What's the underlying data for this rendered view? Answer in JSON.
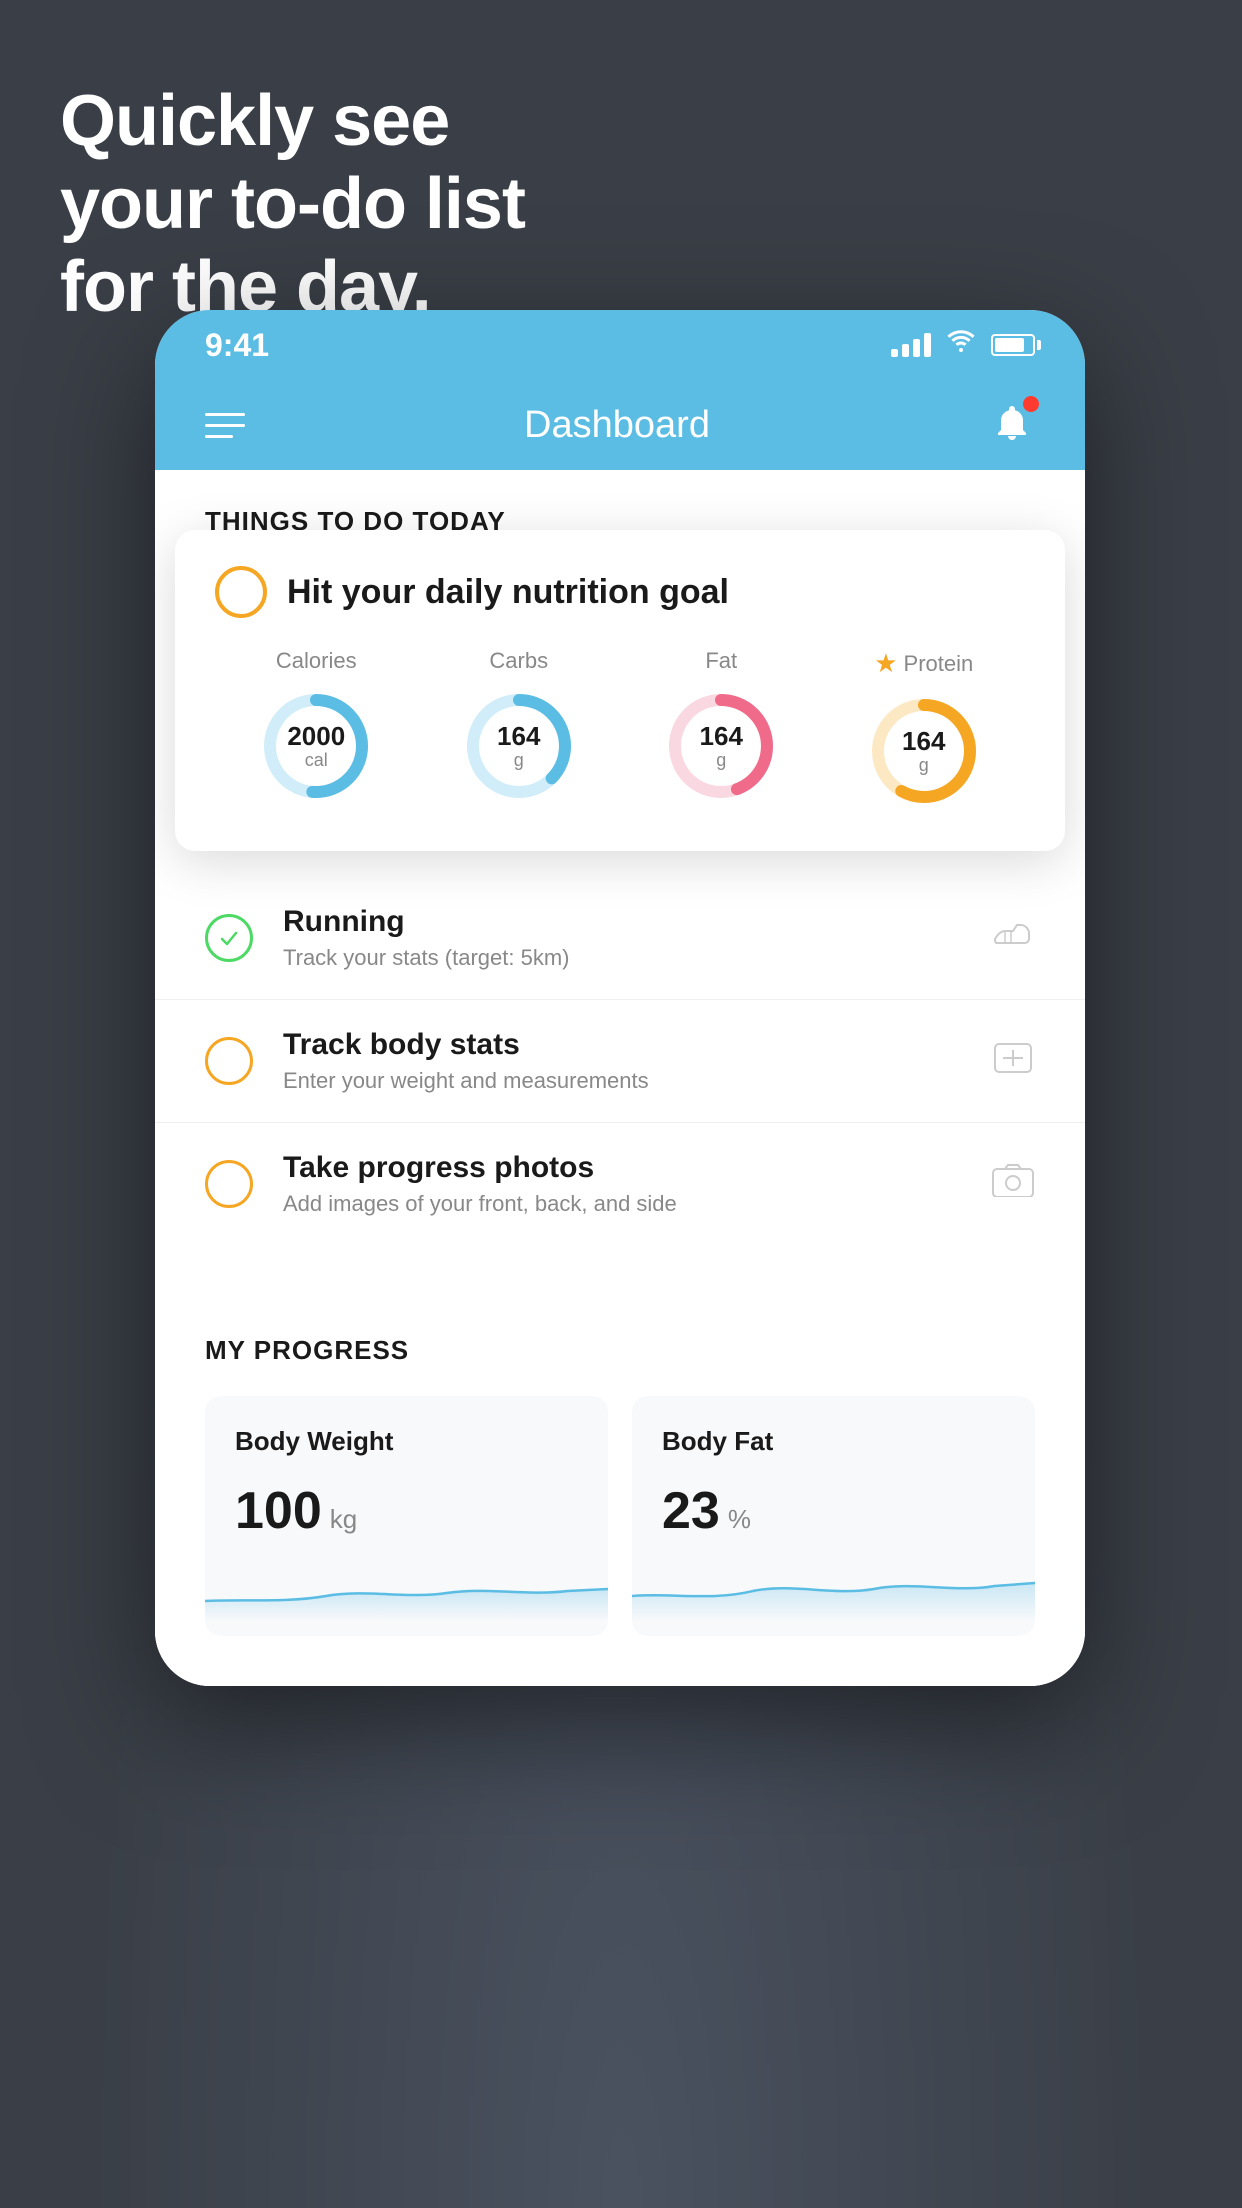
{
  "background": {
    "color": "#3a3f47"
  },
  "headline": {
    "line1": "Quickly see",
    "line2": "your to-do list",
    "line3": "for the day."
  },
  "phone": {
    "statusBar": {
      "time": "9:41"
    },
    "navBar": {
      "title": "Dashboard"
    },
    "sectionHeader": "THINGS TO DO TODAY",
    "nutritionCard": {
      "title": "Hit your daily nutrition goal",
      "items": [
        {
          "label": "Calories",
          "value": "2000",
          "unit": "cal",
          "color": "#5bbde4",
          "trackColor": "#d0edf9"
        },
        {
          "label": "Carbs",
          "value": "164",
          "unit": "g",
          "color": "#5bbde4",
          "trackColor": "#d0edf9"
        },
        {
          "label": "Fat",
          "value": "164",
          "unit": "g",
          "color": "#f06b8a",
          "trackColor": "#fad8e1"
        },
        {
          "label": "Protein",
          "value": "164",
          "unit": "g",
          "color": "#f5a623",
          "trackColor": "#fde8c4",
          "star": true
        }
      ]
    },
    "todoItems": [
      {
        "id": "running",
        "title": "Running",
        "subtitle": "Track your stats (target: 5km)",
        "circleColor": "#4cd964",
        "iconType": "shoe"
      },
      {
        "id": "body-stats",
        "title": "Track body stats",
        "subtitle": "Enter your weight and measurements",
        "circleColor": "#f5a623",
        "iconType": "scale"
      },
      {
        "id": "progress-photos",
        "title": "Take progress photos",
        "subtitle": "Add images of your front, back, and side",
        "circleColor": "#f5a623",
        "iconType": "photo"
      }
    ],
    "progressSection": {
      "header": "MY PROGRESS",
      "cards": [
        {
          "title": "Body Weight",
          "value": "100",
          "unit": "kg"
        },
        {
          "title": "Body Fat",
          "value": "23",
          "unit": "%"
        }
      ]
    }
  }
}
